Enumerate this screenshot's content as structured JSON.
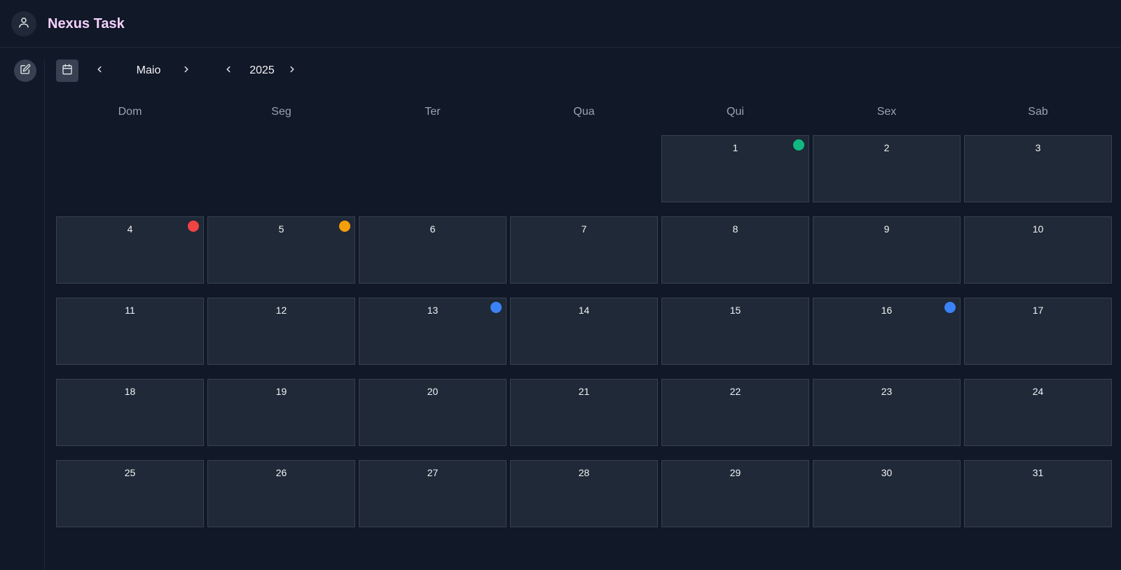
{
  "app": {
    "title": "Nexus Task",
    "avatar_icon": "user-icon",
    "accent": "#f5d0fe"
  },
  "toolbar": {
    "calendar_icon": "calendar-icon",
    "month": "Maio",
    "year": "2025",
    "edit_icon": "edit-icon"
  },
  "weekdays": [
    "Dom",
    "Seg",
    "Ter",
    "Qua",
    "Qui",
    "Sex",
    "Sab"
  ],
  "calendar": {
    "first_weekday_index": 4,
    "days_in_month": 31,
    "markers": [
      {
        "day": 1,
        "color": "#10b981"
      },
      {
        "day": 4,
        "color": "#ef4444"
      },
      {
        "day": 5,
        "color": "#f59e0b"
      },
      {
        "day": 13,
        "color": "#3b82f6"
      },
      {
        "day": 16,
        "color": "#3b82f6"
      }
    ]
  }
}
